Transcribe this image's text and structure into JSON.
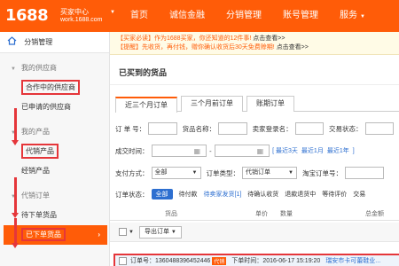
{
  "header": {
    "logo_number": "1688",
    "logo_title": "买家中心",
    "logo_url": "work.1688.com",
    "nav": [
      "首页",
      "诚信金融",
      "分销管理",
      "账号管理",
      "服务"
    ]
  },
  "sidebar": {
    "head": "分销管理",
    "groups": [
      {
        "title": "我的供应商",
        "items": [
          "合作中的供应商",
          "已申请的供应商"
        ]
      },
      {
        "title": "我的产品",
        "items": [
          "代销产品",
          "经销产品"
        ]
      },
      {
        "title": "代销订单",
        "items": [
          "待下单货品",
          "已下单货品"
        ]
      }
    ]
  },
  "notices": [
    {
      "tag": "【买家必读】",
      "text": "作为1688买家，你还知道的12件事!",
      "link": "点击查看>>"
    },
    {
      "tag": "【提醒】",
      "text": "先收货，再付钱，赠你确认收货后30天免费赊期!",
      "link": "点击查看>>"
    }
  ],
  "main": {
    "title": "已买到的货品",
    "tabs": [
      "近三个月订单",
      "三个月前订单",
      "账期订单"
    ],
    "filters": {
      "order_no": "订 单 号：",
      "product_name": "货品名称：",
      "seller_login": "卖家登录名：",
      "trade_status": "交易状态：",
      "created_time": "成交时间：",
      "date_sep": "-",
      "quick_links": [
        "最近3天",
        "最近1月",
        "最近1年"
      ],
      "payment": "支付方式：",
      "payment_value": "全部",
      "order_type": "订单类型：",
      "order_type_value": "代销订单",
      "taobao_order": "淘宝订单号："
    },
    "status_label": "订单状态：",
    "statuses": [
      "全部",
      "待付款",
      "待卖家发货[1]",
      "待确认收货",
      "退款退货中",
      "等待评价",
      "交易"
    ],
    "columns": [
      "货品",
      "单价",
      "数量",
      "总金额"
    ],
    "export_label": "导出订单",
    "order_row": {
      "order_no_label": "订单号：",
      "order_no": "1360488396452446",
      "tag": "代销",
      "time_label": "下单时间：",
      "time": "2016-06-17 15:19:20",
      "seller": "瑞安市卡可蕾鞋业..."
    }
  },
  "colors": {
    "brand": "#ff5c08",
    "highlight": "#e5363a",
    "link": "#2d6fd0"
  }
}
